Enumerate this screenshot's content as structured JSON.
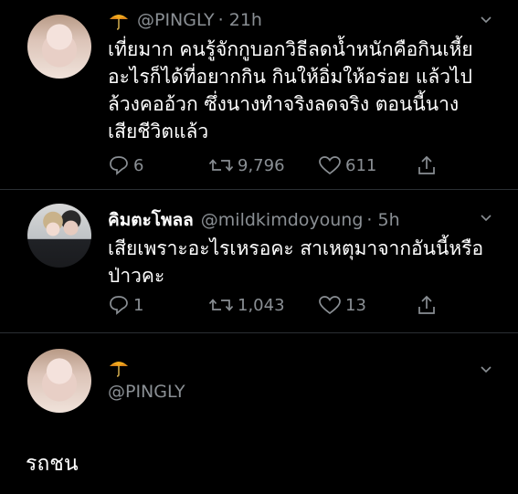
{
  "tweets": [
    {
      "handle": "@PINGLY",
      "time": "· 21h",
      "text": "เที่ยมาก คนรู้จักกูบอกวิธีลดน้ำหนักคือกินเหี้ย\nอะไรก็ได้ที่อยากกิน กินให้อิ่มให้อร่อย แล้วไป\nล้วงคออ้วก ซึ่งนางทำจริงลดจริง ตอนนี้นาง\nเสียชีวิตแล้ว",
      "replies": "6",
      "retweets": "9,796",
      "likes": "611"
    },
    {
      "display_name": "คิมตะโพลล",
      "handle": "@mildkimdoyoung",
      "time": "· 5h",
      "text": "เสียเพราะอะไรเหรอคะ สาเหตุมาจากอันนี้หรือ\nป่าวคะ",
      "replies": "1",
      "retweets": "1,043",
      "likes": "13"
    },
    {
      "handle": "@PINGLY"
    }
  ],
  "main_text": "รถชน",
  "icons": {
    "reply": "reply-icon",
    "retweet": "retweet-icon",
    "like": "heart-icon",
    "share": "share-icon",
    "umbrella": "umbrella-emoji",
    "chevron": "chevron-down-icon"
  },
  "colors": {
    "background": "#000000",
    "text": "#ffffff",
    "muted": "#8a8f94",
    "umbrella": "#f0a81e"
  }
}
